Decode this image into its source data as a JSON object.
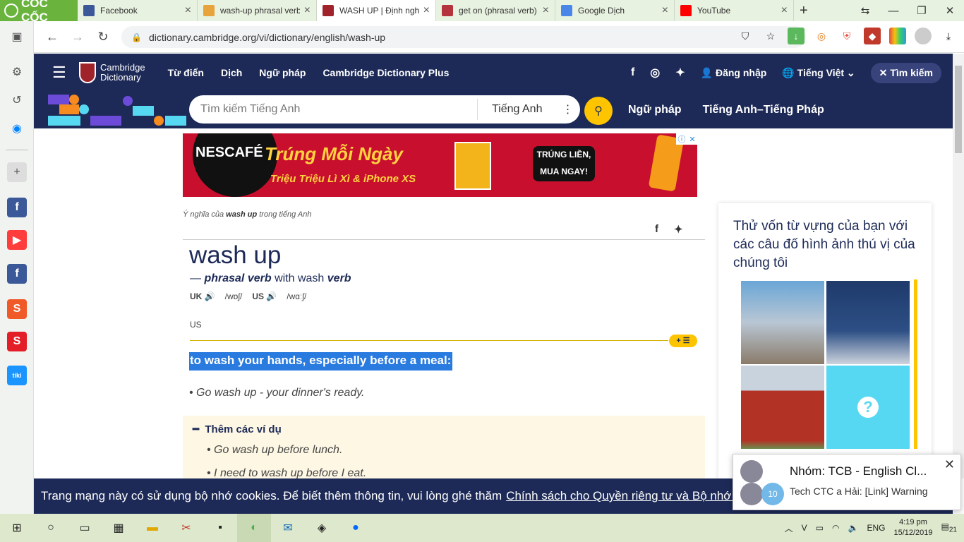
{
  "browser": {
    "brand": "CỐC CỐC",
    "tabs": [
      {
        "title": "Facebook",
        "color": "#3b5998"
      },
      {
        "title": "wash-up phrasal verb",
        "color": "#e8a33d"
      },
      {
        "title": "WASH UP | Định nghĩ",
        "color": "#a0232b"
      },
      {
        "title": "get on (phrasal verb)",
        "color": "#b5333d"
      },
      {
        "title": "Google Dịch",
        "color": "#4a86e8"
      },
      {
        "title": "YouTube",
        "color": "#ff0000"
      }
    ],
    "url": "dictionary.cambridge.org/vi/dictionary/english/wash-up"
  },
  "site": {
    "logo_line1": "Cambridge",
    "logo_line2": "Dictionary",
    "nav": [
      "Từ điển",
      "Dịch",
      "Ngữ pháp",
      "Cambridge Dictionary Plus"
    ],
    "login": "Đăng nhập",
    "language": "Tiếng Việt",
    "search_toggle": "Tìm kiếm",
    "search_placeholder": "Tìm kiếm Tiếng Anh",
    "search_lang": "Tiếng Anh",
    "band_links": [
      "Ngữ pháp",
      "Tiếng Anh–Tiếng Pháp"
    ]
  },
  "ad": {
    "brand": "NESCAFÉ",
    "headline": "Trúng Mỗi Ngày",
    "subline": "Triệu Triệu Lì Xì & iPhone XS",
    "cta_line1": "TRÚNG LIỀN,",
    "cta_line2": "MUA NGAY!"
  },
  "entry": {
    "crumb_pre": "Ý nghĩa của",
    "crumb_word": "wash up",
    "crumb_post": "trong tiếng Anh",
    "headword": "wash up",
    "pos_dash": "—",
    "pos": "phrasal verb",
    "pos_with": "with wash",
    "pos_verb": "verb",
    "uk_label": "UK",
    "uk_ipa": "/wɒʃ/",
    "us_label": "US",
    "us_ipa": "/wɑːʃ/",
    "region": "US",
    "definition": "to wash your hands, especially before a meal:",
    "example": "Go wash up - your dinner's ready.",
    "more_title": "Thêm các ví dụ",
    "more_examples": [
      "Go wash up before lunch.",
      "I need to wash up before I eat."
    ]
  },
  "quiz": {
    "title": "Thử vốn từ vựng của bạn với các câu đố hình ảnh thú vị của chúng tôi"
  },
  "cookie": {
    "text": "Trang mạng này có sử dụng bộ nhớ cookies. Để biết thêm thông tin, vui lòng ghé thăm",
    "link": "Chính sách cho Quyền riêng tư và Bộ nhớ Cookies"
  },
  "notification": {
    "title": "Nhóm: TCB - English Cl...",
    "body": "Tech CTC a Hải: [Link] Warning",
    "badge": "10"
  },
  "taskbar": {
    "language": "ENG",
    "time": "4:19 pm",
    "date": "15/12/2019",
    "notif_count": "21"
  }
}
